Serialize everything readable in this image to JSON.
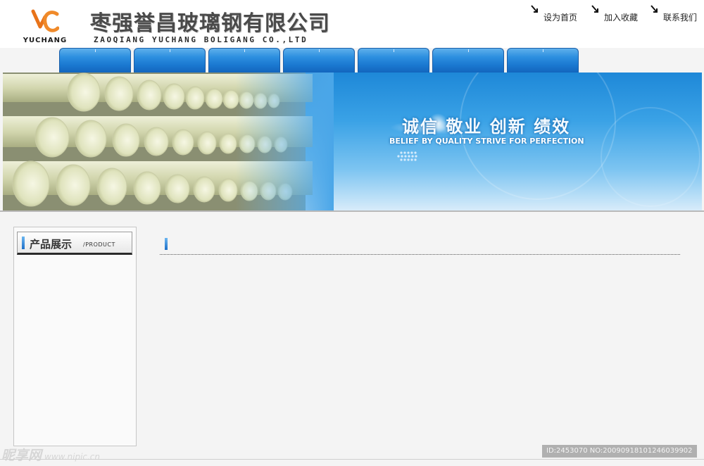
{
  "header": {
    "logo_text": "YUCHANG",
    "company_name_cn": "枣强誉昌玻璃钢有限公司",
    "company_name_en": "ZAOQIANG YUCHANG BOLIGANG CO.,LTD"
  },
  "top_links": [
    {
      "label": "设为首页",
      "icon": "arrow-icon"
    },
    {
      "label": "加入收藏",
      "icon": "arrow-icon"
    },
    {
      "label": "联系我们",
      "icon": "arrow-icon"
    }
  ],
  "nav": {
    "tabs": [
      {
        "label": ""
      },
      {
        "label": ""
      },
      {
        "label": ""
      },
      {
        "label": ""
      },
      {
        "label": ""
      },
      {
        "label": ""
      },
      {
        "label": ""
      }
    ]
  },
  "banner": {
    "slogan_cn": "诚信 敬业 创新 绩效",
    "slogan_en": "BELIEF BY QUALITY  STRIVE FOR PERFECTION"
  },
  "sidebar": {
    "heading_cn": "产品展示",
    "heading_en": "/PRODUCT"
  },
  "main": {
    "title": ""
  },
  "watermark": {
    "site_cn": "昵享网",
    "site_url": "www.nipic.cn",
    "id_text": "ID:2453070 NO:20090918101246039902"
  },
  "colors": {
    "nav_blue": "#1a78d0",
    "banner_blue": "#3aa2e6",
    "logo_orange": "#e8731a"
  }
}
